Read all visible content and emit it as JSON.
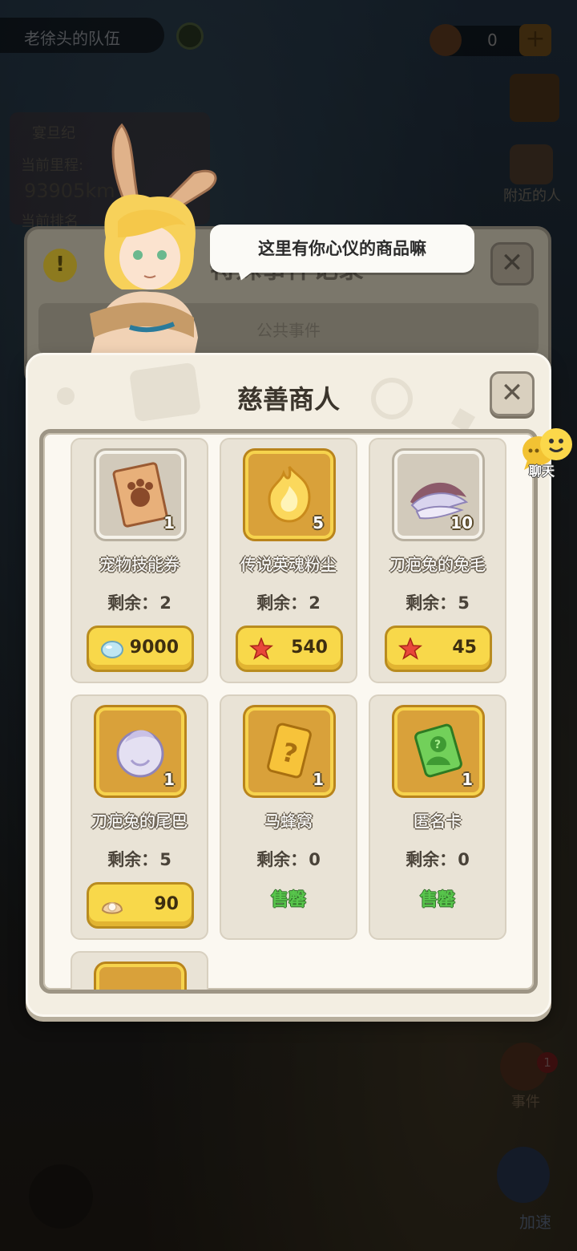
{
  "background": {
    "team_name": "老徐头的队伍",
    "currency_value": "0",
    "nearby_label": "附近的人",
    "left_info": {
      "line1": "宴旦纪",
      "line2": "当前里程:",
      "line3": "93905km",
      "line4": "当前排名"
    },
    "event_label": "事件",
    "event_badge": "1",
    "speed_label": "加速",
    "back_panel": {
      "title": "特殊事件记录",
      "tab": "公共事件"
    }
  },
  "npc": {
    "speech": "这里有你心仪的商品嘛"
  },
  "shop": {
    "title": "慈善商人",
    "remain_label": "剩余：",
    "soldout_label": "售罄",
    "items": [
      {
        "name": "宠物技能券",
        "qty": "1",
        "remain": "2",
        "price": "9000",
        "currency_icon": "pearl-icon",
        "frame": "grey",
        "icon": "pet-skill-ticket-icon",
        "sold_out": false
      },
      {
        "name": "传说英魂粉尘",
        "qty": "5",
        "remain": "2",
        "price": "540",
        "currency_icon": "starfish-icon",
        "frame": "gold",
        "icon": "soul-dust-icon",
        "sold_out": false
      },
      {
        "name": "刀疤兔的兔毛",
        "qty": "10",
        "remain": "5",
        "price": "45",
        "currency_icon": "starfish-icon",
        "frame": "grey",
        "icon": "rabbit-fur-icon",
        "sold_out": false
      },
      {
        "name": "刀疤兔的尾巴",
        "qty": "1",
        "remain": "5",
        "price": "90",
        "currency_icon": "shell-icon",
        "frame": "gold",
        "icon": "rabbit-tail-icon",
        "sold_out": false
      },
      {
        "name": "马蜂窝",
        "qty": "1",
        "remain": "0",
        "price": "",
        "currency_icon": "",
        "frame": "gold",
        "icon": "mystery-card-icon",
        "sold_out": true
      },
      {
        "name": "匿名卡",
        "qty": "1",
        "remain": "0",
        "price": "",
        "currency_icon": "",
        "frame": "gold",
        "icon": "anonymous-card-icon",
        "sold_out": true
      }
    ]
  },
  "chat": {
    "label": "聊天"
  }
}
